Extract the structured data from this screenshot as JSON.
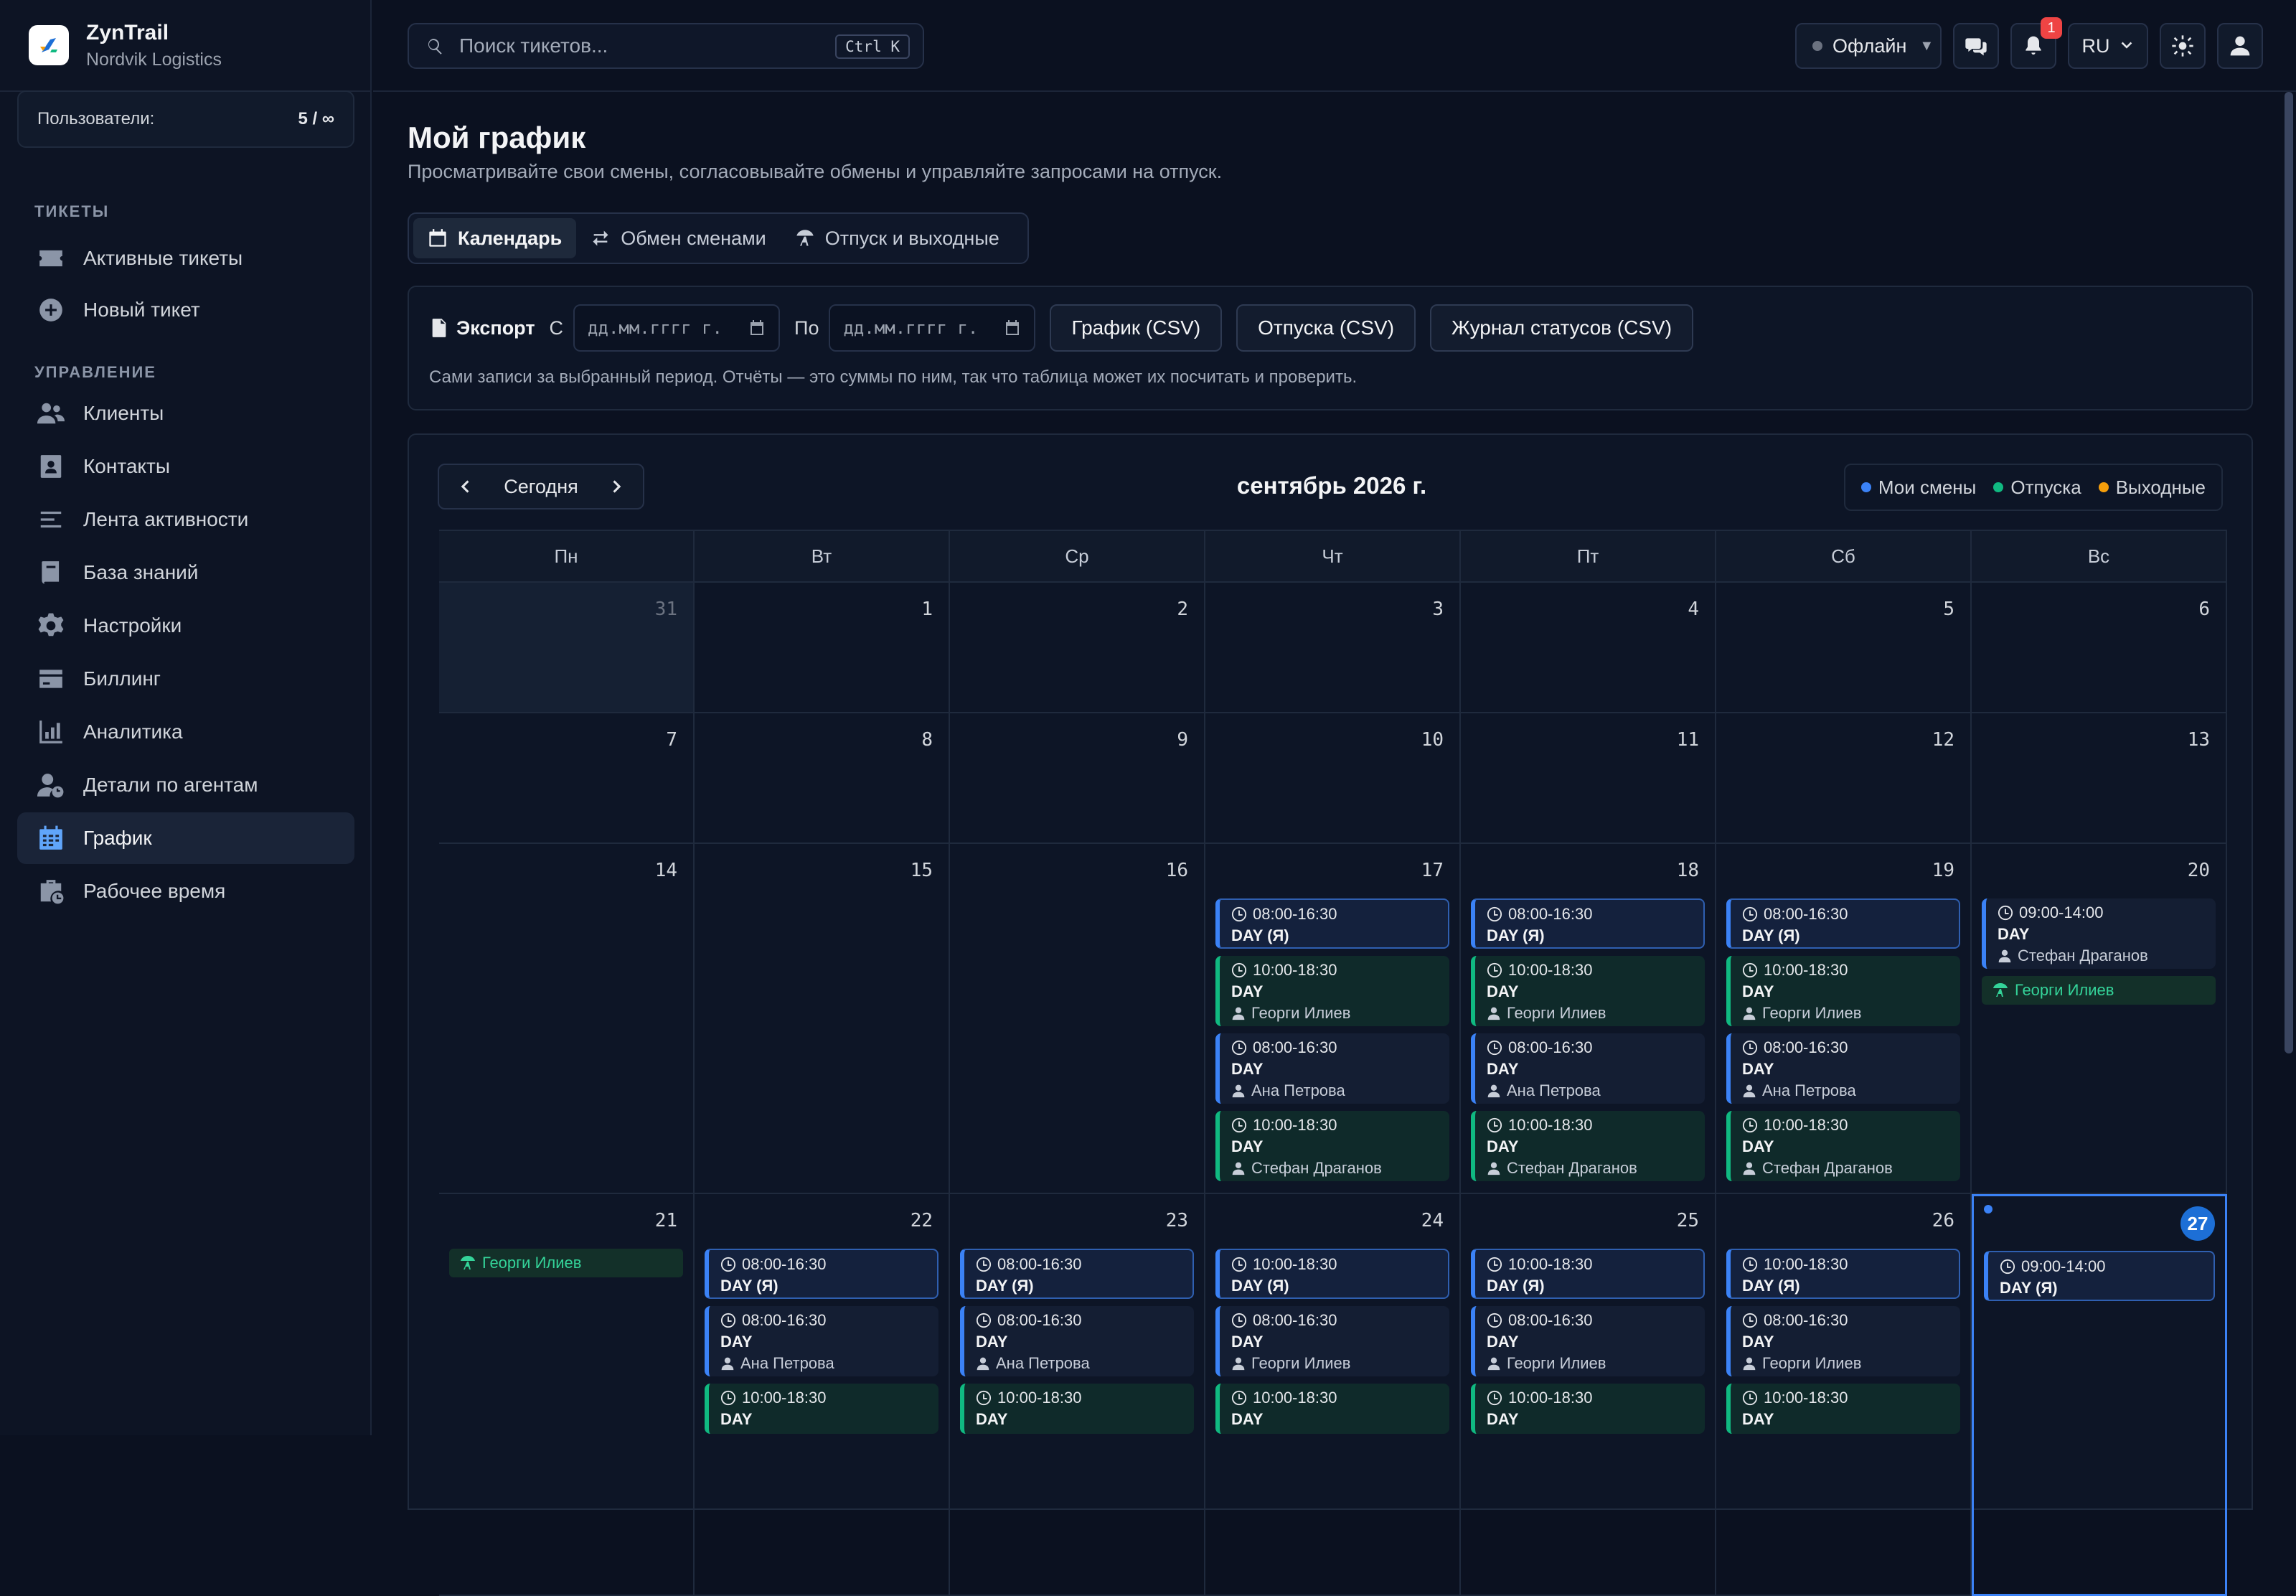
{
  "app": {
    "name": "ZynTrail",
    "org": "Nordvik Logistics"
  },
  "users": {
    "label": "Пользователи:",
    "value": "5 / ∞"
  },
  "sidebar": {
    "section_tickets": "ТИКЕТЫ",
    "section_manage": "УПРАВЛЕНИЕ",
    "items": [
      {
        "label": "Активные тикеты",
        "icon": "ticket-icon"
      },
      {
        "label": "Новый тикет",
        "icon": "plus-circle-icon"
      },
      {
        "label": "Клиенты",
        "icon": "users-icon"
      },
      {
        "label": "Контакты",
        "icon": "contact-icon"
      },
      {
        "label": "Лента активности",
        "icon": "list-icon"
      },
      {
        "label": "База знаний",
        "icon": "book-icon"
      },
      {
        "label": "Настройки",
        "icon": "gear-icon"
      },
      {
        "label": "Биллинг",
        "icon": "card-icon"
      },
      {
        "label": "Аналитика",
        "icon": "chart-icon"
      },
      {
        "label": "Детали по агентам",
        "icon": "agent-icon"
      },
      {
        "label": "График",
        "icon": "calendar-icon",
        "active": true
      },
      {
        "label": "Рабочее время",
        "icon": "clock-case-icon"
      }
    ]
  },
  "topbar": {
    "search_placeholder": "Поиск тикетов...",
    "search_shortcut": "Ctrl K",
    "status": "Офлайн",
    "notifications": "1",
    "lang": "RU"
  },
  "page": {
    "title": "Мой график",
    "subtitle": "Просматривайте свои смены, согласовывайте обмены и управляйте запросами на отпуск.",
    "tabs": [
      {
        "label": "Календарь",
        "icon": "calendar-icon"
      },
      {
        "label": "Обмен сменами",
        "icon": "swap-icon"
      },
      {
        "label": "Отпуск и выходные",
        "icon": "beach-icon"
      }
    ]
  },
  "export": {
    "label": "Экспорт",
    "from": "С",
    "to": "По",
    "date_placeholder": "дд.мм.гггг г.",
    "buttons": [
      "График (CSV)",
      "Отпуска (CSV)",
      "Журнал статусов (CSV)"
    ],
    "note": "Сами записи за выбранный период. Отчёты — это суммы по ним, так что таблица может их посчитать и проверить."
  },
  "calendar": {
    "today_label": "Сегодня",
    "month": "сентябрь 2026 г.",
    "legend": [
      {
        "label": "Мои смены",
        "color": "#3b82f6"
      },
      {
        "label": "Отпуска",
        "color": "#10b981"
      },
      {
        "label": "Выходные",
        "color": "#f59e0b"
      }
    ],
    "weekdays": [
      "Пн",
      "Вт",
      "Ср",
      "Чт",
      "Пт",
      "Сб",
      "Вс"
    ],
    "weeks": [
      [
        {
          "d": "31",
          "other": true,
          "events": []
        },
        {
          "d": "1",
          "events": []
        },
        {
          "d": "2",
          "events": []
        },
        {
          "d": "3",
          "events": []
        },
        {
          "d": "4",
          "events": []
        },
        {
          "d": "5",
          "events": []
        },
        {
          "d": "6",
          "events": []
        }
      ],
      [
        {
          "d": "7",
          "events": []
        },
        {
          "d": "8",
          "events": []
        },
        {
          "d": "9",
          "events": []
        },
        {
          "d": "10",
          "events": []
        },
        {
          "d": "11",
          "events": []
        },
        {
          "d": "12",
          "events": []
        },
        {
          "d": "13",
          "events": []
        }
      ],
      [
        {
          "d": "14",
          "events": []
        },
        {
          "d": "15",
          "events": []
        },
        {
          "d": "16",
          "events": []
        },
        {
          "d": "17",
          "events": [
            {
              "kind": "mine",
              "time": "08:00-16:30",
              "name": "DAY (Я)"
            },
            {
              "kind": "green",
              "time": "10:00-18:30",
              "name": "DAY",
              "person": "Георги Илиев"
            },
            {
              "kind": "blue",
              "time": "08:00-16:30",
              "name": "DAY",
              "person": "Ана Петрова"
            },
            {
              "kind": "green",
              "time": "10:00-18:30",
              "name": "DAY",
              "person": "Стефан Драганов"
            }
          ]
        },
        {
          "d": "18",
          "events": [
            {
              "kind": "mine",
              "time": "08:00-16:30",
              "name": "DAY (Я)"
            },
            {
              "kind": "green",
              "time": "10:00-18:30",
              "name": "DAY",
              "person": "Георги Илиев"
            },
            {
              "kind": "blue",
              "time": "08:00-16:30",
              "name": "DAY",
              "person": "Ана Петрова"
            },
            {
              "kind": "green",
              "time": "10:00-18:30",
              "name": "DAY",
              "person": "Стефан Драганов"
            }
          ]
        },
        {
          "d": "19",
          "events": [
            {
              "kind": "mine",
              "time": "08:00-16:30",
              "name": "DAY (Я)"
            },
            {
              "kind": "green",
              "time": "10:00-18:30",
              "name": "DAY",
              "person": "Георги Илиев"
            },
            {
              "kind": "blue",
              "time": "08:00-16:30",
              "name": "DAY",
              "person": "Ана Петрова"
            },
            {
              "kind": "green",
              "time": "10:00-18:30",
              "name": "DAY",
              "person": "Стефан Драганов"
            }
          ]
        },
        {
          "d": "20",
          "events": [
            {
              "kind": "blue",
              "time": "09:00-14:00",
              "name": "DAY",
              "person": "Стефан Драганов"
            }
          ],
          "vacation": "Георги Илиев"
        }
      ],
      [
        {
          "d": "21",
          "events": [],
          "vacation": "Георги Илиев"
        },
        {
          "d": "22",
          "events": [
            {
              "kind": "mine",
              "time": "08:00-16:30",
              "name": "DAY (Я)"
            },
            {
              "kind": "blue",
              "time": "08:00-16:30",
              "name": "DAY",
              "person": "Ана Петрова"
            },
            {
              "kind": "green",
              "time": "10:00-18:30",
              "name": "DAY"
            }
          ]
        },
        {
          "d": "23",
          "events": [
            {
              "kind": "mine",
              "time": "08:00-16:30",
              "name": "DAY (Я)"
            },
            {
              "kind": "blue",
              "time": "08:00-16:30",
              "name": "DAY",
              "person": "Ана Петрова"
            },
            {
              "kind": "green",
              "time": "10:00-18:30",
              "name": "DAY"
            }
          ]
        },
        {
          "d": "24",
          "events": [
            {
              "kind": "mine",
              "time": "10:00-18:30",
              "name": "DAY (Я)"
            },
            {
              "kind": "blue",
              "time": "08:00-16:30",
              "name": "DAY",
              "person": "Георги Илиев"
            },
            {
              "kind": "green",
              "time": "10:00-18:30",
              "name": "DAY"
            }
          ]
        },
        {
          "d": "25",
          "events": [
            {
              "kind": "mine",
              "time": "10:00-18:30",
              "name": "DAY (Я)"
            },
            {
              "kind": "blue",
              "time": "08:00-16:30",
              "name": "DAY",
              "person": "Георги Илиев"
            },
            {
              "kind": "green",
              "time": "10:00-18:30",
              "name": "DAY"
            }
          ]
        },
        {
          "d": "26",
          "events": [
            {
              "kind": "mine",
              "time": "10:00-18:30",
              "name": "DAY (Я)"
            },
            {
              "kind": "blue",
              "time": "08:00-16:30",
              "name": "DAY",
              "person": "Георги Илиев"
            },
            {
              "kind": "green",
              "time": "10:00-18:30",
              "name": "DAY"
            }
          ]
        },
        {
          "d": "27",
          "today": true,
          "events": [
            {
              "kind": "mine",
              "time": "09:00-14:00",
              "name": "DAY (Я)"
            }
          ]
        }
      ]
    ]
  }
}
